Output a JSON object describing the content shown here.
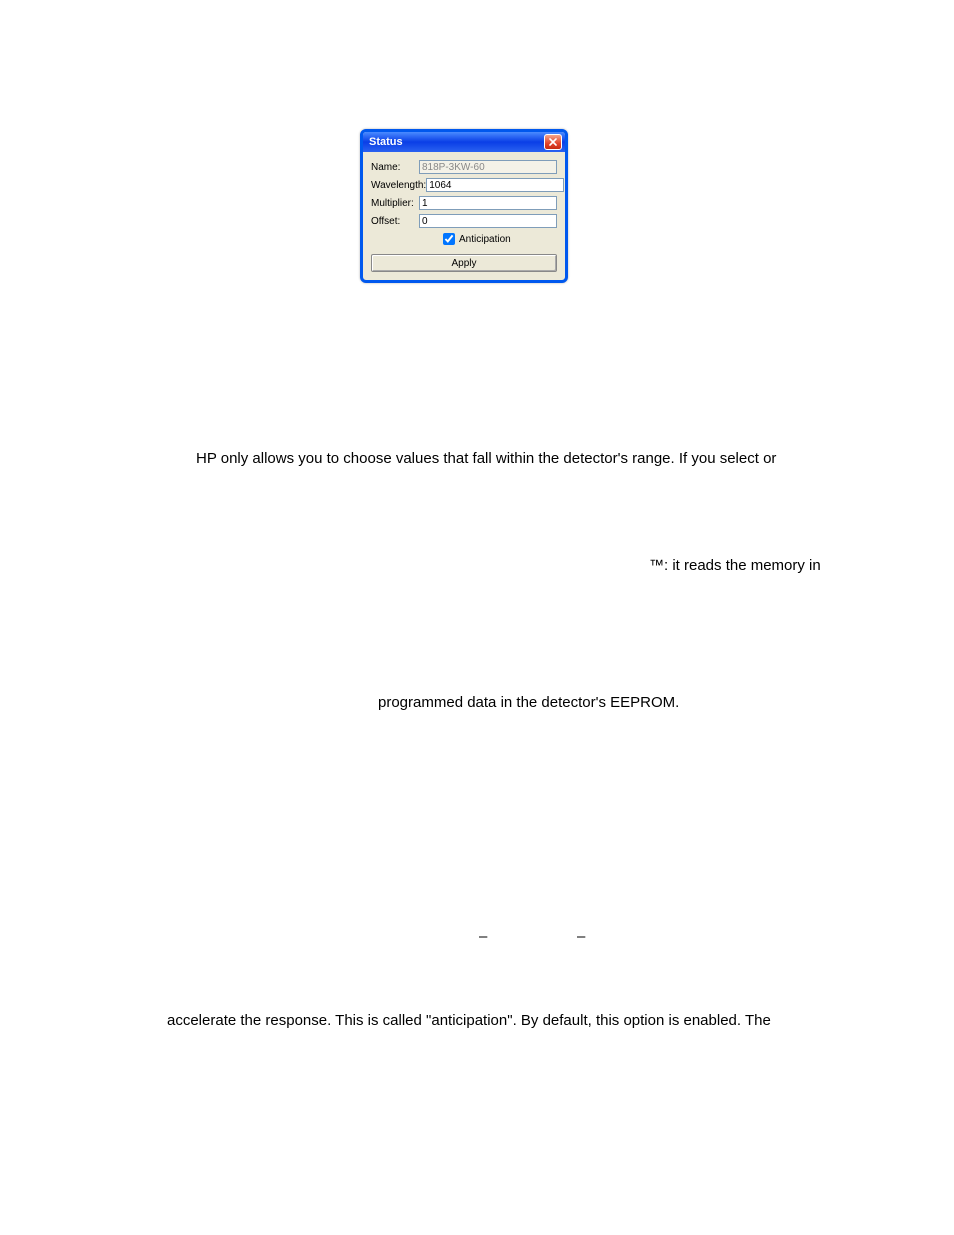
{
  "dialog": {
    "title": "Status",
    "close_aria": "Close",
    "labels": {
      "name": "Name:",
      "wavelength": "Wavelength:",
      "multiplier": "Multiplier:",
      "offset": "Offset:"
    },
    "values": {
      "name": "818P-3KW-60",
      "wavelength": "1064",
      "multiplier": "1",
      "offset": "0"
    },
    "anticipation_label": "Anticipation",
    "anticipation_checked": true,
    "apply_label": "Apply"
  },
  "fragments": {
    "f1": "HP only allows you to choose values that fall within the detector's range.  If you select or",
    "f2": "™: it reads the memory in",
    "f3": "programmed data in the detector's EEPROM.",
    "f4": "accelerate the response.  This is called \"anticipation\".  By default, this option is enabled.  The",
    "dash1": "–",
    "dash2": "–"
  }
}
